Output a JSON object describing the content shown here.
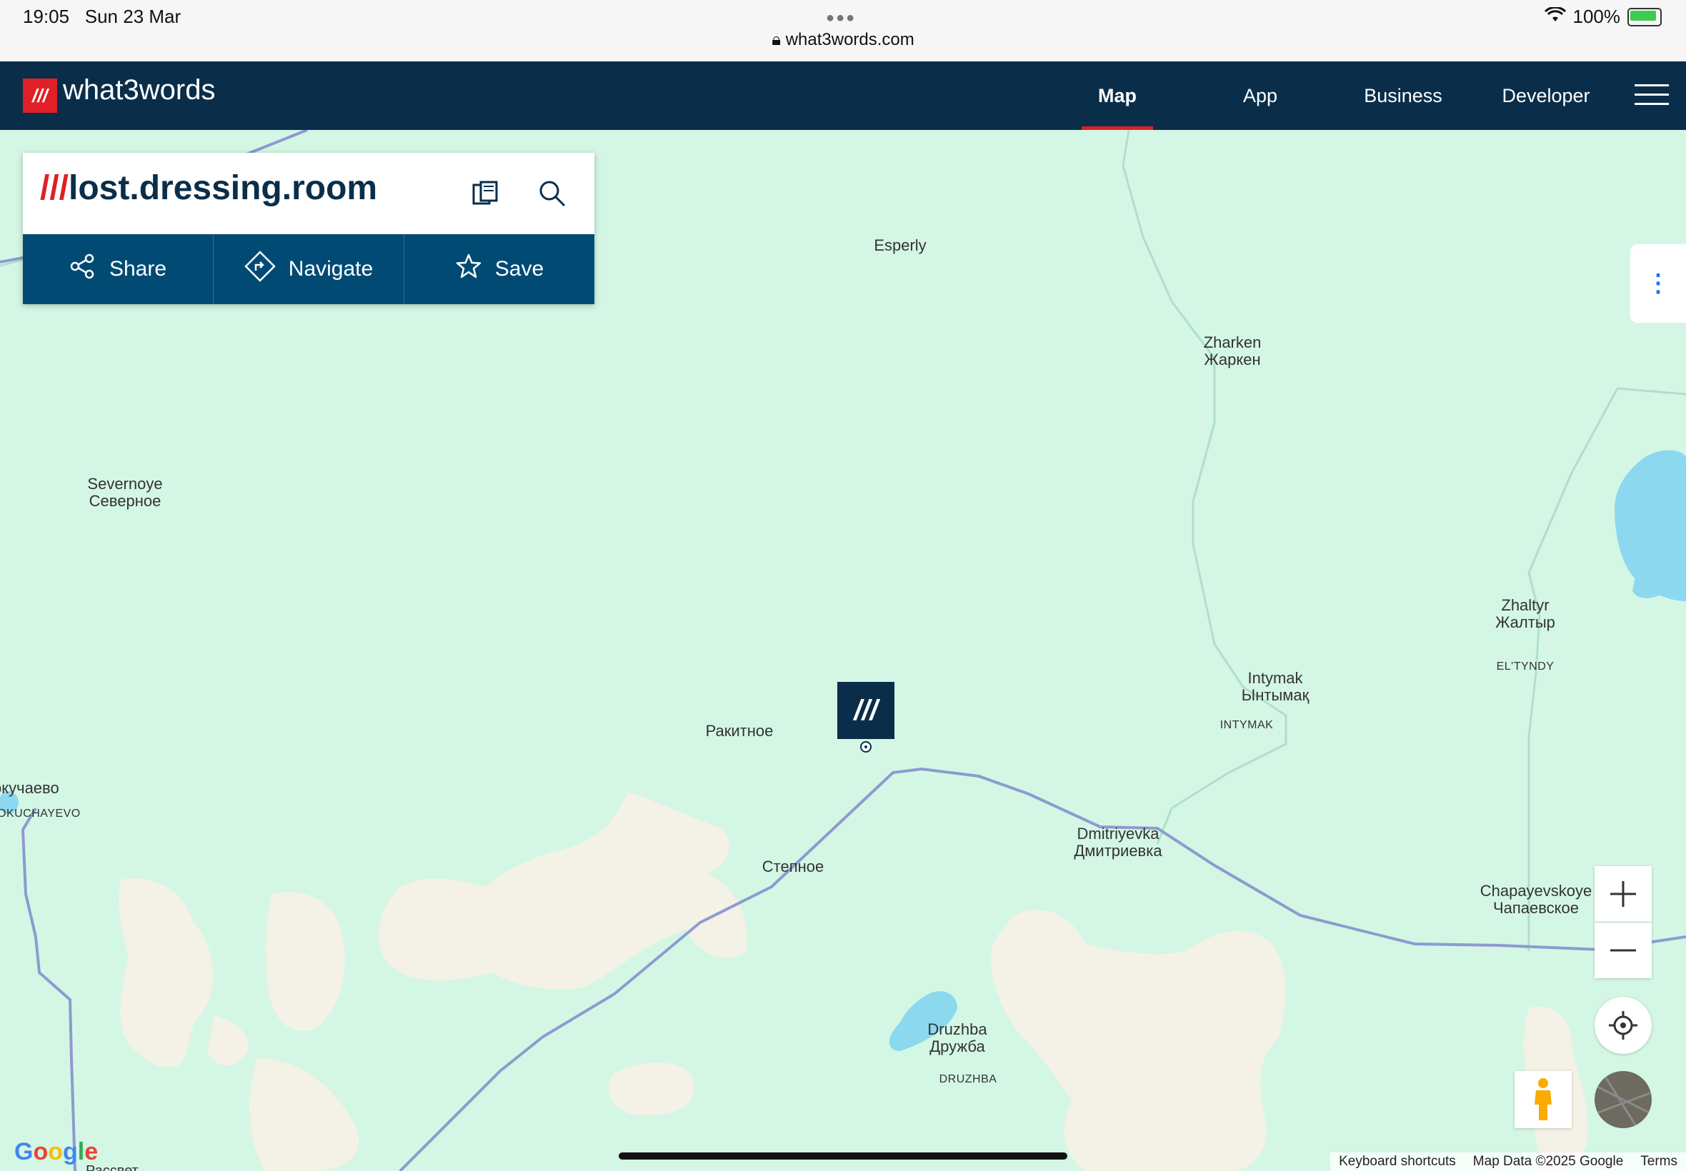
{
  "status_bar": {
    "time": "19:05",
    "date": "Sun 23 Mar",
    "url": "what3words.com",
    "battery": "100%"
  },
  "header": {
    "logo_mark": "///",
    "logo_text": "what3words",
    "nav": [
      {
        "label": "Map",
        "active": true
      },
      {
        "label": "App",
        "active": false
      },
      {
        "label": "Business",
        "active": false
      },
      {
        "label": "Developer",
        "active": false
      }
    ],
    "menu_icon": "hamburger-icon"
  },
  "address_card": {
    "slashes": "///",
    "words": "lost.dressing.room",
    "copy_icon": "copy-icon",
    "search_icon": "search-icon",
    "actions": [
      {
        "label": "Share",
        "icon": "share-icon"
      },
      {
        "label": "Navigate",
        "icon": "navigate-icon"
      },
      {
        "label": "Save",
        "icon": "star-icon"
      }
    ]
  },
  "map": {
    "pin_label": "///",
    "places": {
      "esperly": "Esperly",
      "zharken_lat": "Zharken",
      "zharken_cyr": "Жаркен",
      "severnoye_lat": "Severnoye",
      "severnoye_cyr": "Северное",
      "zhaltyr_lat": "Zhaltyr",
      "zhaltyr_cyr": "Жалтыр",
      "eltyndy": "EL'TYNDY",
      "intymak_lat": "Intymak",
      "intymak_cyr": "Ынтымақ",
      "intymak_caps": "INTYMAK",
      "rakitnoe": "Ракитное",
      "kuchaevo_cyr": "окучаево",
      "kuchaevo_caps": "OKUCHAYEVO",
      "stepnoe": "Степное",
      "dmitriyevka_lat": "Dmitriyevka",
      "dmitriyevka_cyr": "Дмитриевка",
      "chapayevskoye_lat": "Chapayevskoye",
      "chapayevskoye_cyr": "Чапаевское",
      "druzhba_lat": "Druzhba",
      "druzhba_cyr": "Дружба",
      "druzhba_caps": "DRUZHBA",
      "rassvet": "Рассвет"
    },
    "controls": {
      "more_icon": "more-vertical-icon",
      "zoom_in_icon": "plus-icon",
      "zoom_out_icon": "minus-icon",
      "locate_icon": "crosshair-icon",
      "pegman_icon": "pegman-icon"
    },
    "colors": {
      "land": "#d3f7e4",
      "urban": "#f4f1e6",
      "water": "#8cd8ef",
      "road": "#9aa8d8",
      "brand_red": "#e11f26",
      "brand_navy": "#0a2e4a"
    }
  },
  "footer": {
    "google": "Google",
    "keyboard_shortcuts": "Keyboard shortcuts",
    "map_data": "Map Data ©2025 Google",
    "terms": "Terms"
  }
}
